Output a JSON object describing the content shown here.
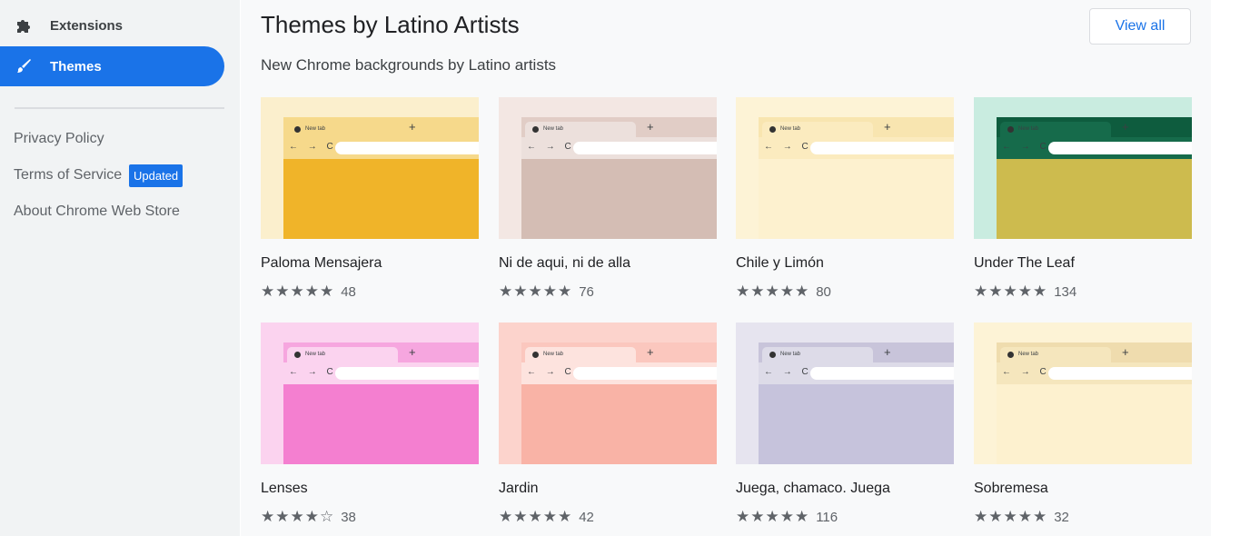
{
  "sidebar": {
    "nav": [
      {
        "label": "Extensions",
        "icon": "puzzle-icon"
      },
      {
        "label": "Themes",
        "icon": "brush-icon",
        "active": true
      }
    ],
    "links": [
      "Privacy Policy",
      "Terms of Service",
      "About Chrome Web Store"
    ],
    "badge": "Updated"
  },
  "section": {
    "title": "Themes by Latino Artists",
    "subtitle": "New Chrome backgrounds by Latino artists",
    "view_all": "View all"
  },
  "theme_preview": {
    "tab_label": "New tab",
    "plus": "+",
    "nav_glyphs": "← → C"
  },
  "themes": [
    {
      "name": "Paloma Mensajera",
      "rating": 5,
      "count": "48",
      "colors": {
        "bg": "#fbefcd",
        "tab": "#f6d98b",
        "bar": "#f6d98b",
        "art": "#f0b429"
      }
    },
    {
      "name": "Ni de aqui, ni de alla",
      "rating": 5,
      "count": "76",
      "colors": {
        "bg": "#f3e7e3",
        "tab": "#ece0dc",
        "bar": "#e1cdc6",
        "art": "#d4bdb4"
      }
    },
    {
      "name": "Chile y Limón",
      "rating": 5,
      "count": "80",
      "colors": {
        "bg": "#fdf3d6",
        "tab": "#fbebbf",
        "bar": "#f8e5b0",
        "art": "#fdf1cf"
      }
    },
    {
      "name": "Under The Leaf",
      "rating": 5,
      "count": "134",
      "colors": {
        "bg": "#c9ece0",
        "tab": "#166b4b",
        "bar": "#0e5c3e",
        "art": "#cdbb4e"
      }
    },
    {
      "name": "Lenses",
      "rating": 4.5,
      "count": "38",
      "colors": {
        "bg": "#fbd3ef",
        "tab": "#fbd3ef",
        "bar": "#f6a6df",
        "art": "#f47fd0"
      }
    },
    {
      "name": "Jardin",
      "rating": 5,
      "count": "42",
      "colors": {
        "bg": "#fcd3cc",
        "tab": "#fde3de",
        "bar": "#fbc7be",
        "art": "#f9b3a6"
      }
    },
    {
      "name": "Juega, chamaco. Juega",
      "rating": 5,
      "count": "116",
      "colors": {
        "bg": "#e6e4ef",
        "tab": "#dddbe8",
        "bar": "#c8c4da",
        "art": "#c6c3dc"
      }
    },
    {
      "name": "Sobremesa",
      "rating": 5,
      "count": "32",
      "colors": {
        "bg": "#fdf3d6",
        "tab": "#f5e6bd",
        "bar": "#efdcae",
        "art": "#fdf1cf"
      }
    }
  ]
}
